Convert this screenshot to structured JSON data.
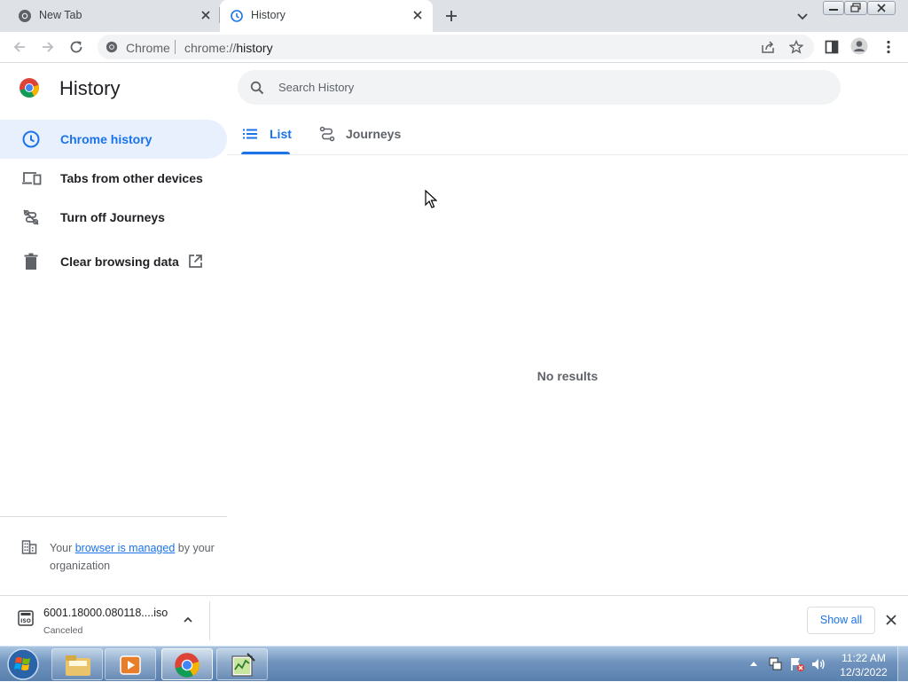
{
  "browser": {
    "tabs": [
      {
        "title": "New Tab",
        "active": false
      },
      {
        "title": "History",
        "active": true
      }
    ],
    "omnibox": {
      "site_label": "Chrome",
      "url_scheme": "chrome://",
      "url_host": "history"
    }
  },
  "page": {
    "title": "History",
    "search_placeholder": "Search History",
    "sidebar": {
      "items": [
        {
          "label": "Chrome history",
          "icon": "clock-icon",
          "selected": true
        },
        {
          "label": "Tabs from other devices",
          "icon": "devices-icon",
          "selected": false
        },
        {
          "label": "Turn off Journeys",
          "icon": "journeys-off-icon",
          "selected": false
        },
        {
          "label": "Clear browsing data",
          "icon": "trash-icon",
          "selected": false
        }
      ],
      "managed": {
        "prefix": "Your ",
        "link": "browser is managed",
        "suffix": " by your organization"
      }
    },
    "tabs": [
      {
        "label": "List",
        "icon": "list-icon",
        "selected": true
      },
      {
        "label": "Journeys",
        "icon": "journeys-icon",
        "selected": false
      }
    ],
    "empty_message": "No results"
  },
  "download_shelf": {
    "file_name": "6001.18000.080118....iso",
    "file_icon_text": "ISO",
    "status": "Canceled",
    "show_all_label": "Show all"
  },
  "taskbar": {
    "time": "11:22 AM",
    "date": "12/3/2022"
  },
  "colors": {
    "accent": "#1a73e8",
    "selected_bg": "#e8f0fe",
    "tabstrip_bg": "#dee1e6"
  }
}
